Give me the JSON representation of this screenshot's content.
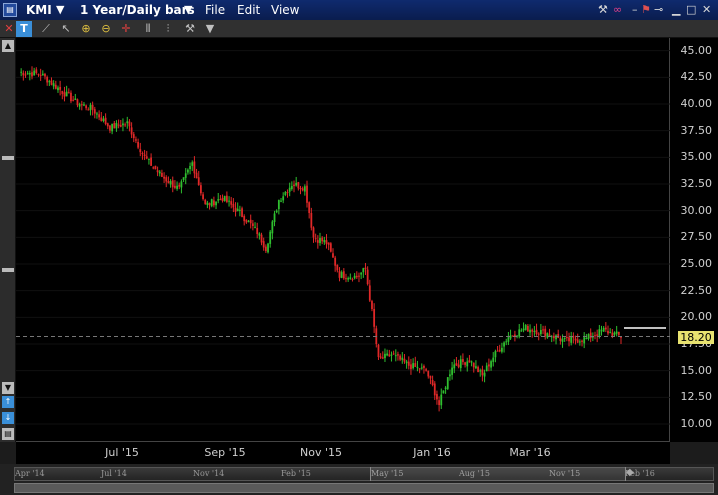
{
  "window": {
    "symbol": "KMI",
    "period": "1 Year/Daily bars",
    "menus": [
      "File",
      "Edit",
      "View"
    ]
  },
  "toolbar": {
    "text_tool": "T"
  },
  "chart_data": {
    "type": "candlestick",
    "ylim": [
      8.5,
      46
    ],
    "y_ticks": [
      45,
      42.5,
      40,
      37.5,
      35,
      32.5,
      30,
      27.5,
      25,
      22.5,
      20,
      17.5,
      15,
      12.5,
      10
    ],
    "y_tick_labels": [
      "45.00",
      "42.50",
      "40.00",
      "37.50",
      "35.00",
      "32.50",
      "30.00",
      "27.50",
      "25.00",
      "22.50",
      "20.00",
      "17.50",
      "15.00",
      "12.50",
      "10.00"
    ],
    "x_tick_labels": [
      "Jul '15",
      "Sep '15",
      "Nov '15",
      "Jan '16",
      "Mar '16"
    ],
    "last_price": 18.2,
    "last_price_label": "18.20",
    "colors": {
      "up": "#2fbf2f",
      "down": "#e02828",
      "background": "#000000",
      "grid": "#555555"
    },
    "anchors": [
      {
        "t": 0,
        "v": 43.0
      },
      {
        "t": 10,
        "v": 42.8
      },
      {
        "t": 18,
        "v": 41.5
      },
      {
        "t": 26,
        "v": 40.2
      },
      {
        "t": 34,
        "v": 39.5
      },
      {
        "t": 42,
        "v": 37.8
      },
      {
        "t": 50,
        "v": 38.2
      },
      {
        "t": 58,
        "v": 35.0
      },
      {
        "t": 66,
        "v": 33.2
      },
      {
        "t": 74,
        "v": 32.0
      },
      {
        "t": 80,
        "v": 34.5
      },
      {
        "t": 86,
        "v": 30.5
      },
      {
        "t": 94,
        "v": 31.2
      },
      {
        "t": 102,
        "v": 29.8
      },
      {
        "t": 110,
        "v": 28.0
      },
      {
        "t": 114,
        "v": 26.5
      },
      {
        "t": 120,
        "v": 31.0
      },
      {
        "t": 126,
        "v": 32.5
      },
      {
        "t": 132,
        "v": 32.2
      },
      {
        "t": 136,
        "v": 27.5
      },
      {
        "t": 142,
        "v": 27.0
      },
      {
        "t": 148,
        "v": 24.0
      },
      {
        "t": 156,
        "v": 23.8
      },
      {
        "t": 160,
        "v": 24.5
      },
      {
        "t": 163,
        "v": 20.5
      },
      {
        "t": 166,
        "v": 16.0
      },
      {
        "t": 172,
        "v": 16.5
      },
      {
        "t": 180,
        "v": 15.5
      },
      {
        "t": 188,
        "v": 15.0
      },
      {
        "t": 192,
        "v": 13.0
      },
      {
        "t": 194,
        "v": 11.8
      },
      {
        "t": 200,
        "v": 15.5
      },
      {
        "t": 208,
        "v": 16.0
      },
      {
        "t": 214,
        "v": 14.5
      },
      {
        "t": 218,
        "v": 16.0
      },
      {
        "t": 226,
        "v": 18.2
      },
      {
        "t": 234,
        "v": 19.0
      },
      {
        "t": 244,
        "v": 18.5
      },
      {
        "t": 252,
        "v": 17.8
      },
      {
        "t": 262,
        "v": 18.0
      },
      {
        "t": 270,
        "v": 18.8
      },
      {
        "t": 278,
        "v": 18.2
      }
    ]
  },
  "navigator": {
    "labels": [
      "Apr '14",
      "Jul '14",
      "Nov '14",
      "Feb '15",
      "May '15",
      "Aug '15",
      "Nov '15",
      "Feb '16"
    ]
  }
}
